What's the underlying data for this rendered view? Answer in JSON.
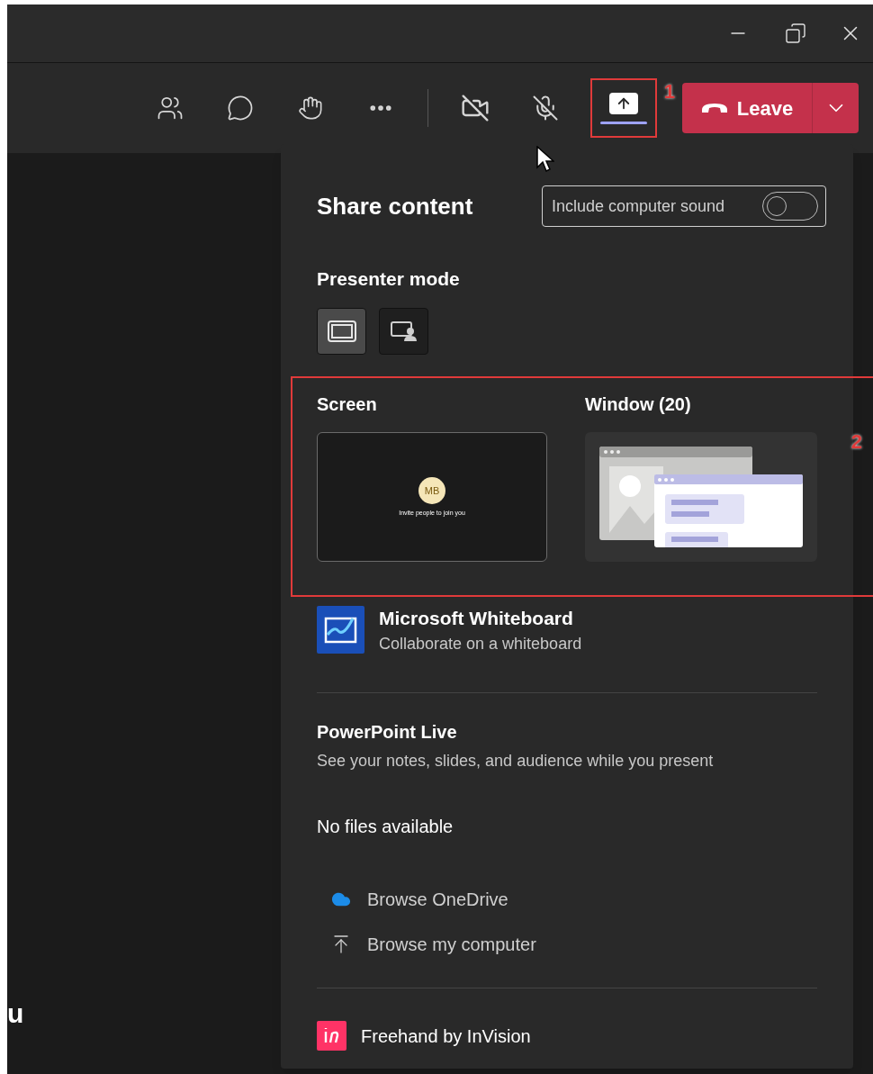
{
  "toolbar": {
    "share_selected": true,
    "leave": {
      "label": "Leave"
    }
  },
  "background_text": "u",
  "share_panel": {
    "title": "Share content",
    "computer_sound": {
      "label": "Include computer sound",
      "on": false
    },
    "presenter_mode": {
      "label": "Presenter mode",
      "modes": [
        {
          "kind": "content-only",
          "selected": true
        },
        {
          "kind": "standout",
          "selected": false
        }
      ]
    },
    "sources": [
      {
        "kind": "screen",
        "label": "Screen",
        "thumbnail": {
          "initials": "MB",
          "caption": "Invite people to join you"
        }
      },
      {
        "kind": "window",
        "label": "Window (20)"
      }
    ],
    "whiteboard": {
      "title": "Microsoft Whiteboard",
      "subtitle": "Collaborate on a whiteboard"
    },
    "powerpoint": {
      "title": "PowerPoint Live",
      "subtitle": "See your notes, slides, and audience while you present",
      "empty": "No files available",
      "links": [
        {
          "kind": "onedrive",
          "label": "Browse OneDrive"
        },
        {
          "kind": "computer",
          "label": "Browse my computer"
        }
      ]
    },
    "freehand": {
      "label": "Freehand by InVision"
    }
  },
  "annotations": [
    "1",
    "2"
  ]
}
